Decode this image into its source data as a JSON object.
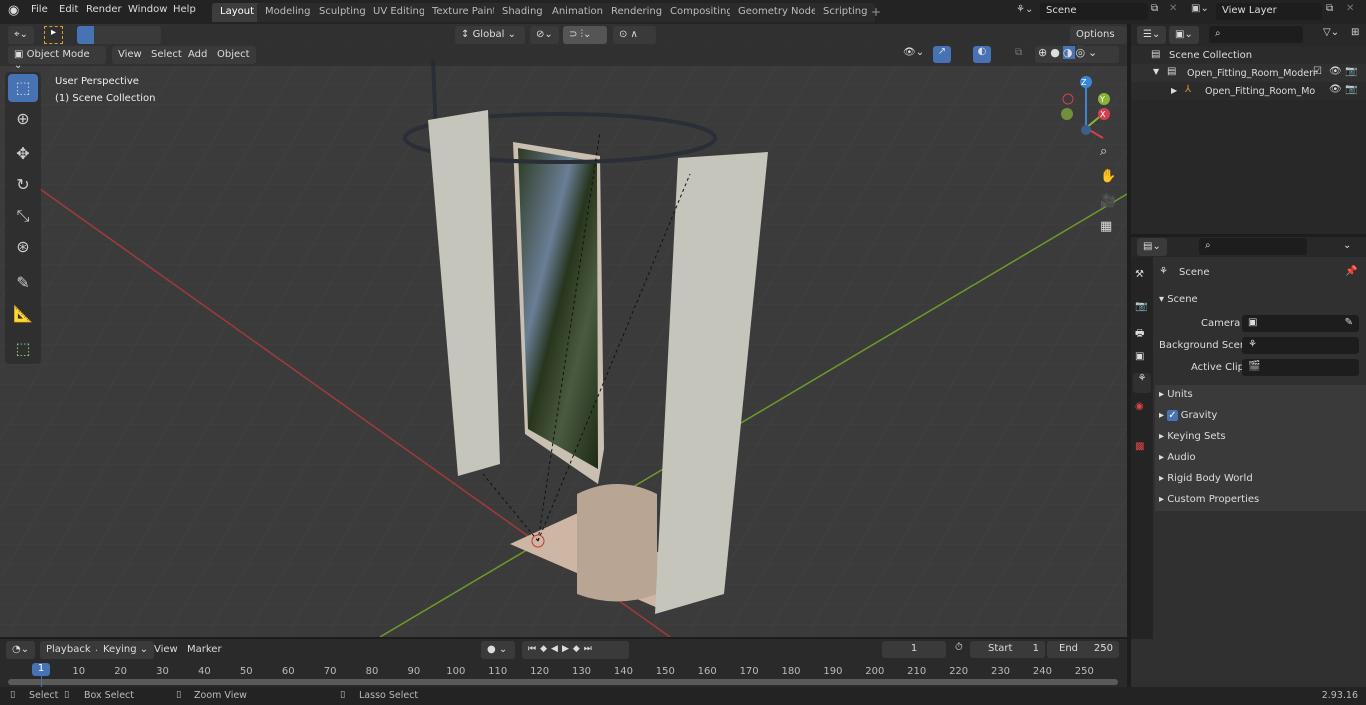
{
  "menu": [
    "File",
    "Edit",
    "Render",
    "Window",
    "Help"
  ],
  "workspaces": [
    "Layout",
    "Modeling",
    "Sculpting",
    "UV Editing",
    "Texture Paint",
    "Shading",
    "Animation",
    "Rendering",
    "Compositing",
    "Geometry Nodes",
    "Scripting"
  ],
  "active_workspace": "Layout",
  "scene_field": "Scene",
  "view_layer_field": "View Layer",
  "header": {
    "mode": "Object Mode",
    "menus": [
      "View",
      "Select",
      "Add",
      "Object"
    ],
    "transform_orientation": "Global",
    "options": "Options"
  },
  "viewport": {
    "perspective": "User Perspective",
    "collection": "(1) Scene Collection",
    "gizmo": {
      "x": "X",
      "y": "Y",
      "z": "Z"
    }
  },
  "outliner": {
    "root": "Scene Collection",
    "items": [
      {
        "label": "Open_Fitting_Room_Modern_",
        "type": "collection"
      },
      {
        "label": "Open_Fitting_Room_Moc",
        "type": "object"
      }
    ]
  },
  "properties": {
    "context": "Scene",
    "section": "Scene",
    "fields": [
      {
        "label": "Camera",
        "value": ""
      },
      {
        "label": "Background Scene",
        "value": ""
      },
      {
        "label": "Active Clip",
        "value": ""
      }
    ],
    "panels": [
      "Units",
      "Gravity",
      "Keying Sets",
      "Audio",
      "Rigid Body World",
      "Custom Properties"
    ],
    "gravity_checked": true
  },
  "timeline": {
    "menus": [
      "Playback",
      "Keying",
      "View",
      "Marker"
    ],
    "current_frame": "1",
    "start_label": "Start",
    "start": "1",
    "end_label": "End",
    "end": "250",
    "playhead": "1",
    "ticks": [
      "10",
      "20",
      "30",
      "40",
      "50",
      "60",
      "70",
      "80",
      "90",
      "100",
      "110",
      "120",
      "130",
      "140",
      "150",
      "160",
      "170",
      "180",
      "190",
      "200",
      "210",
      "220",
      "230",
      "240",
      "250"
    ]
  },
  "status": {
    "select": "Select",
    "box_select": "Box Select",
    "zoom_view": "Zoom View",
    "lasso_select": "Lasso Select",
    "version": "2.93.16"
  },
  "colors": {
    "accent": "#4772b3",
    "x_axis": "#a33a3a",
    "y_axis": "#6e9a2a"
  }
}
